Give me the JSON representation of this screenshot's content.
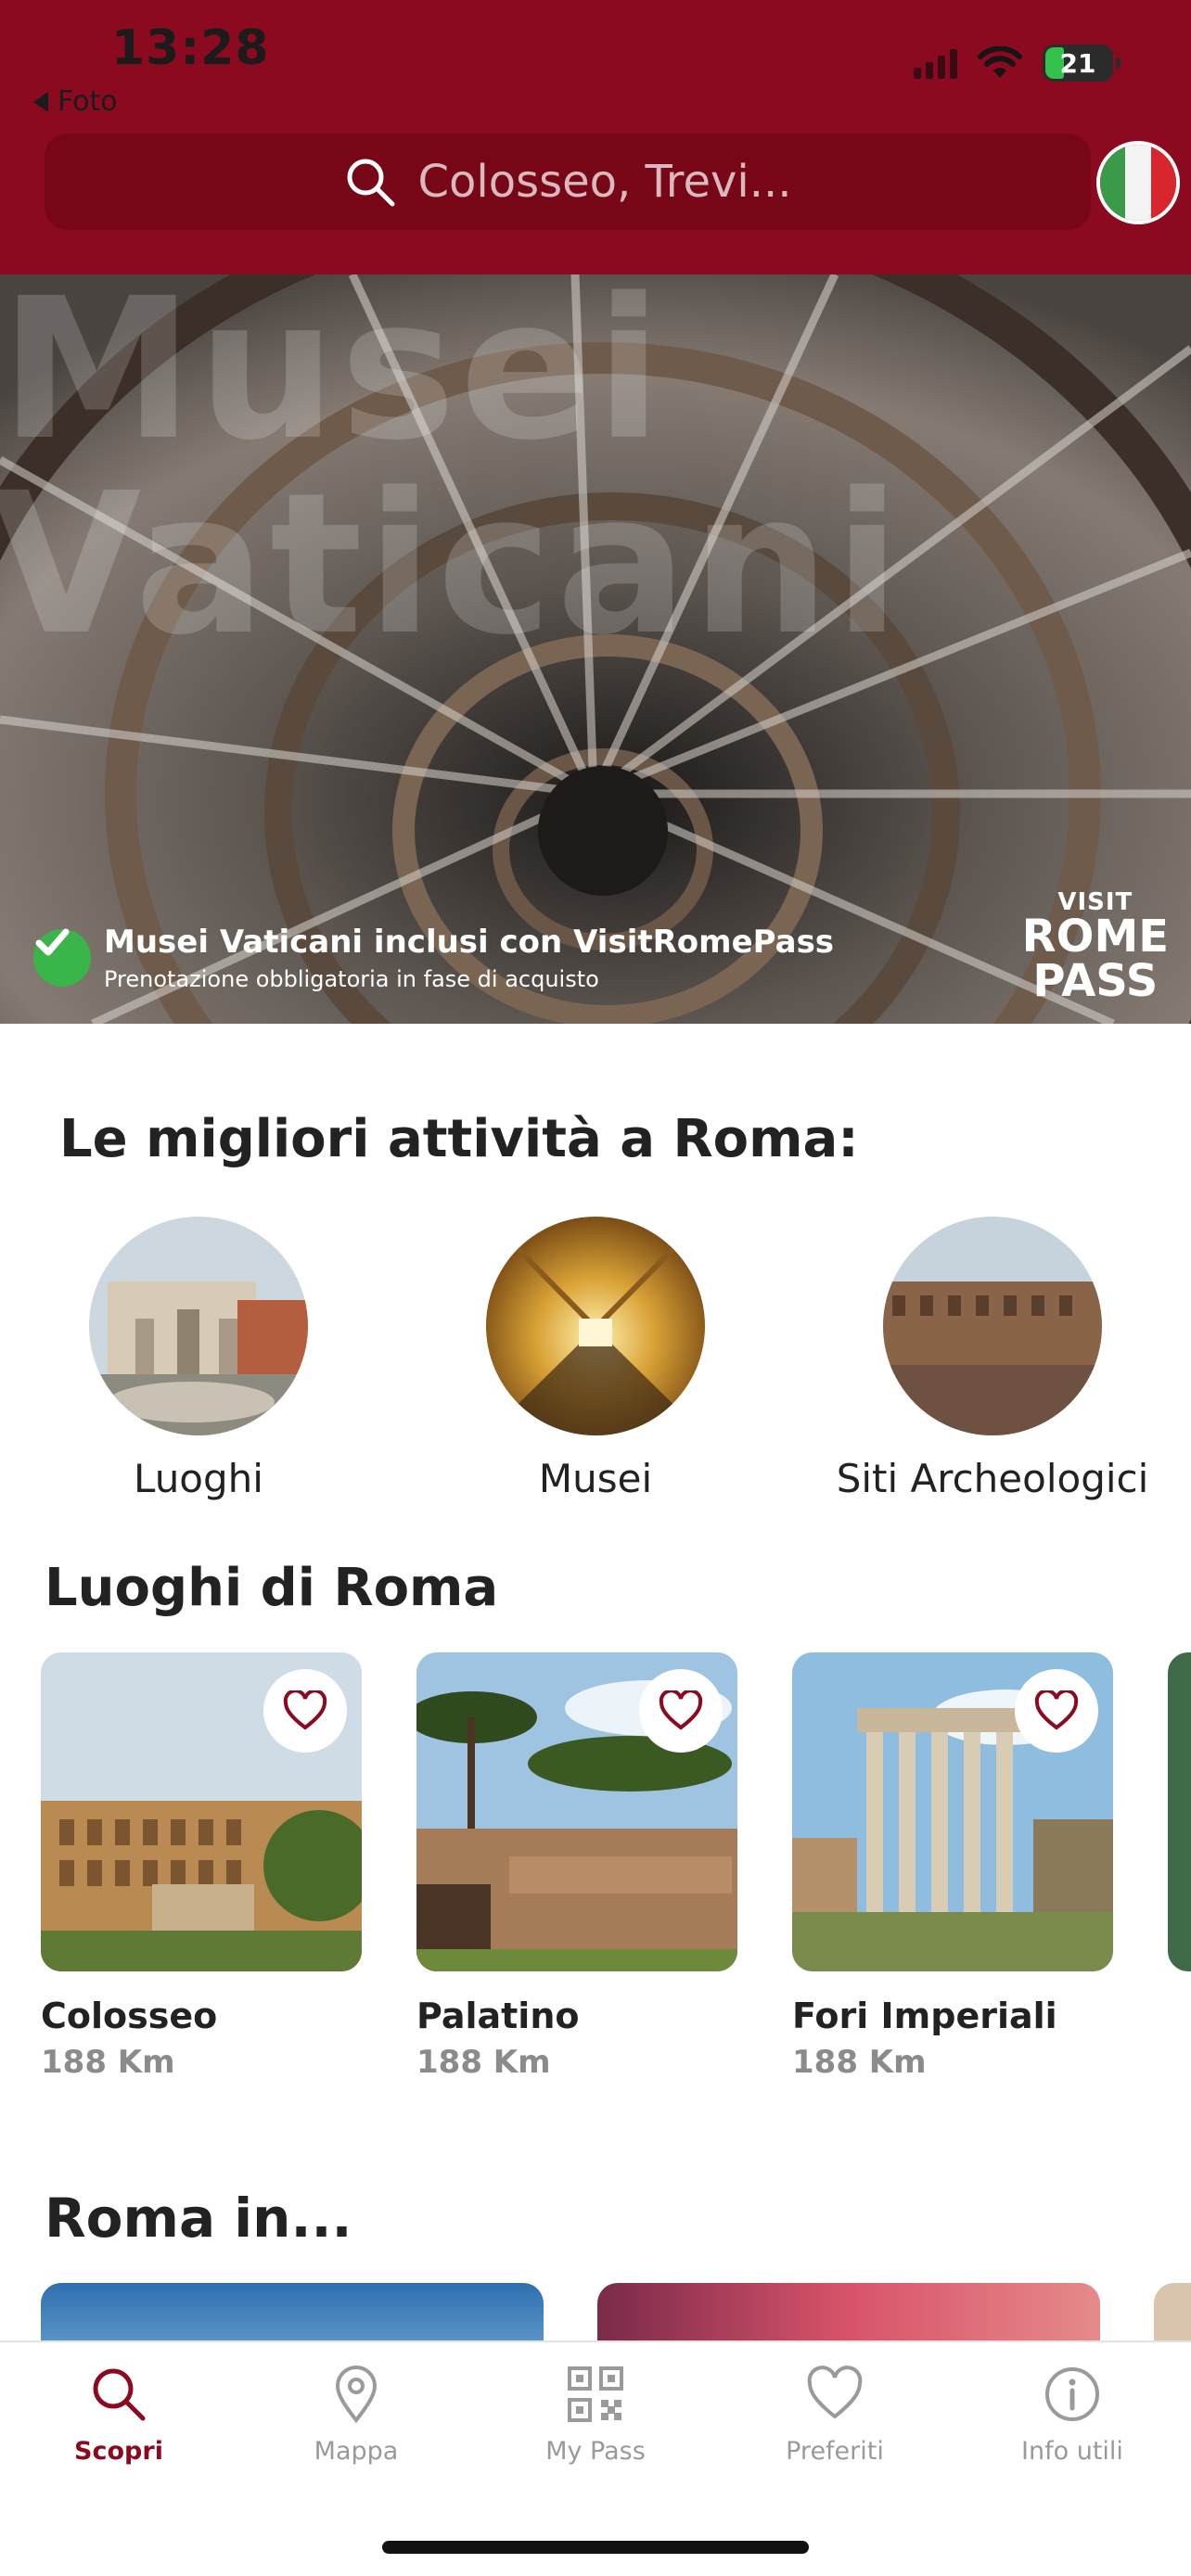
{
  "status_bar": {
    "time": "13:28",
    "back_label": "Foto",
    "battery": "21"
  },
  "search": {
    "placeholder": "Colosseo, Trevi..."
  },
  "hero": {
    "background_text": [
      "Musei",
      "Vaticani"
    ],
    "caption_title": "Musei Vaticani inclusi con VisitRomePass",
    "caption_subtitle": "Prenotazione obbligatoria in fase di acquisto",
    "logo_visit": "VISIT",
    "logo_rome": "ROME",
    "logo_pass": "PASS"
  },
  "activities": {
    "title": "Le migliori attività a Roma:",
    "items": [
      {
        "label": "Luoghi"
      },
      {
        "label": "Musei"
      },
      {
        "label": "Siti Archeologici"
      }
    ]
  },
  "places": {
    "title": "Luoghi di Roma",
    "items": [
      {
        "name": "Colosseo",
        "distance": "188 Km"
      },
      {
        "name": "Palatino",
        "distance": "188 Km"
      },
      {
        "name": "Fori Imperiali",
        "distance": "188 Km"
      }
    ]
  },
  "roma_in": {
    "title": "Roma in..."
  },
  "tabbar": {
    "tabs": [
      {
        "label": "Scopri",
        "icon": "search-icon",
        "active": true
      },
      {
        "label": "Mappa",
        "icon": "map-pin-icon"
      },
      {
        "label": "My Pass",
        "icon": "qr-code-icon"
      },
      {
        "label": "Preferiti",
        "icon": "heart-icon"
      },
      {
        "label": "Info utili",
        "icon": "info-icon"
      }
    ]
  },
  "colors": {
    "brand": "#8c0a1f",
    "search_bg": "#770616",
    "inactive_tab": "#9a9a9a"
  }
}
